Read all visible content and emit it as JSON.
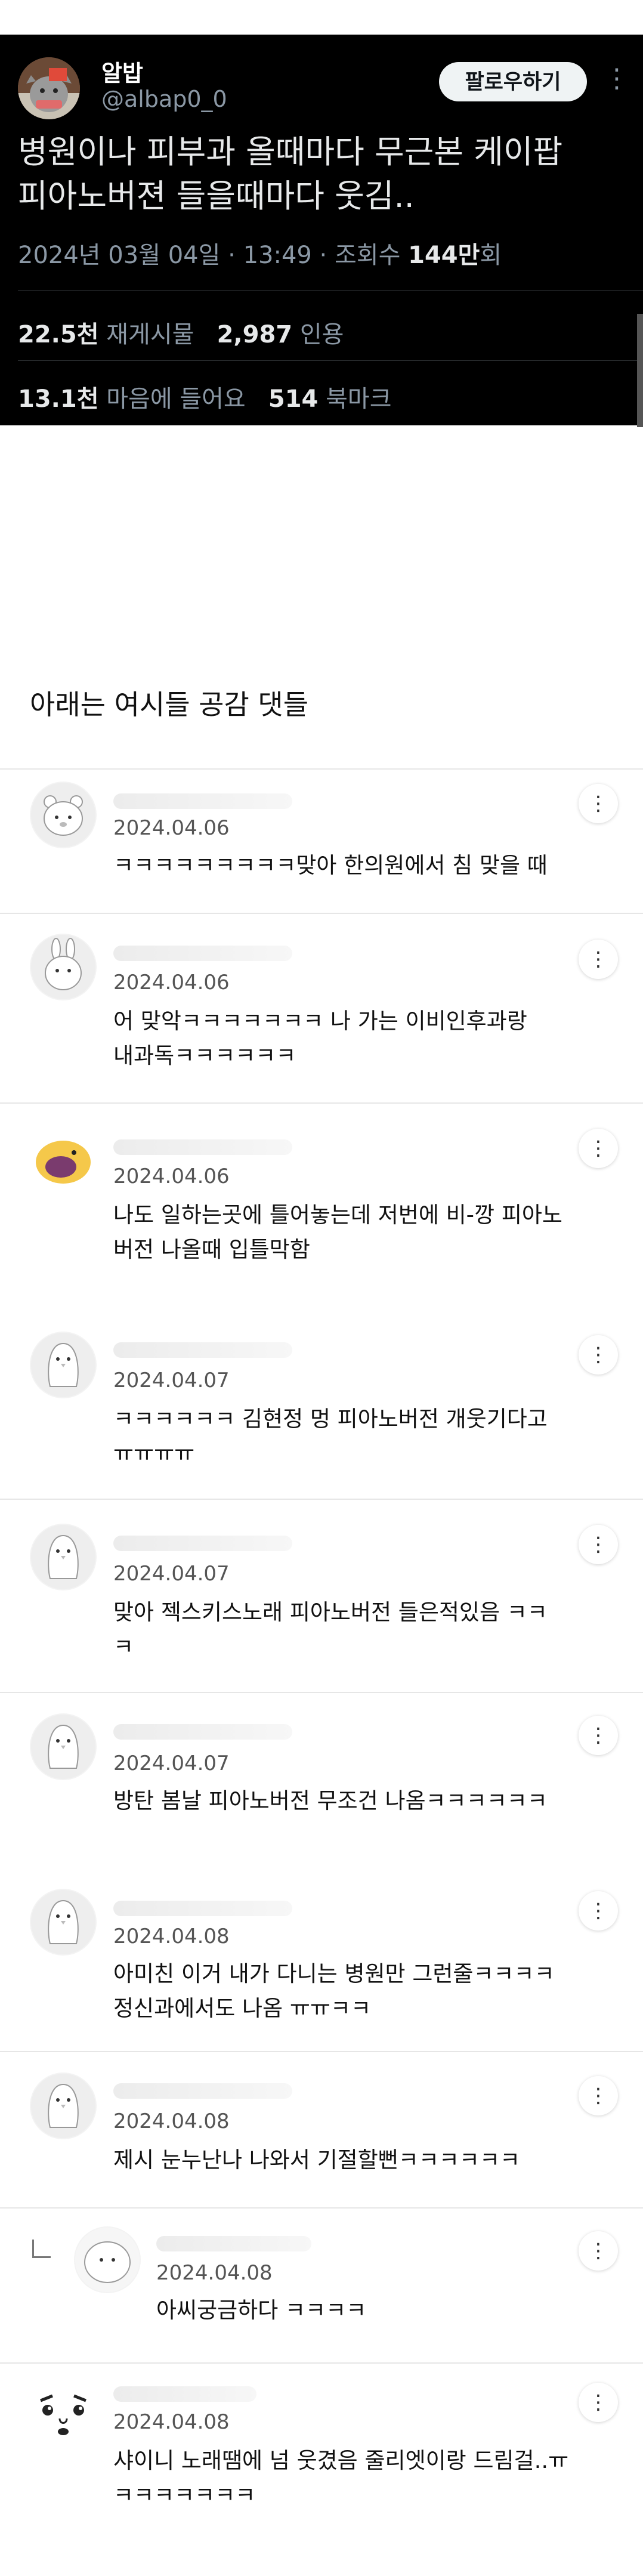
{
  "tweet": {
    "name": "알밥",
    "handle": "@albap0_0",
    "follow_label": "팔로우하기",
    "more_icon": "⋮",
    "text": "병원이나 피부과 올때마다 무근본 케이팝\n피아노버젼 들을때마다 웃김..",
    "meta_date": "2024년 03월 04일 · 13:49 · 조회수 ",
    "meta_views": "144만",
    "meta_views_unit": "회",
    "retweets": "22.5천",
    "retweets_label": " 재게시물",
    "quotes": "2,987",
    "quotes_label": " 인용",
    "likes": "13.1천",
    "likes_label": " 마음에 들어요",
    "bookmarks": "514",
    "bookmarks_label": " 북마크"
  },
  "section_title": "아래는 여시들 공감 댓들",
  "kebab_icon": "⋮",
  "comments": [
    {
      "date": "2024.04.06",
      "text": "ㅋㅋㅋㅋㅋㅋㅋㅋㅋ맞아 한의원에서 침 맞을 때"
    },
    {
      "date": "2024.04.06",
      "text": "어 맞악ㅋㅋㅋㅋㅋㅋㅋ 나 가는 이비인후과랑\n내과독ㅋㅋㅋㅋㅋㅋ"
    },
    {
      "date": "2024.04.06",
      "text": "나도 일하는곳에 틀어놓는데 저번에 비-깡 피아노\n버전 나올때 입틀막함"
    },
    {
      "date": "2024.04.07",
      "text": "ㅋㅋㅋㅋㅋㅋ 김현정 멍 피아노버전 개웃기다고\nㅠㅠㅠㅠ"
    },
    {
      "date": "2024.04.07",
      "text": "맞아 젝스키스노래 피아노버전 들은적있음 ㅋㅋ\nㅋ"
    },
    {
      "date": "2024.04.07",
      "text": "방탄 봄날 피아노버전 무조건 나옴ㅋㅋㅋㅋㅋㅋ"
    },
    {
      "date": "2024.04.08",
      "text": "아미친 이거 내가 다니는 병원만 그런줄ㅋㅋㅋㅋ\n정신과에서도 나옴 ㅠㅠㅋㅋ"
    },
    {
      "date": "2024.04.08",
      "text": "제시 눈누난나 나와서 기절할뻔ㅋㅋㅋㅋㅋㅋ"
    },
    {
      "date": "2024.04.08",
      "text": "아씨궁금하다 ㅋㅋㅋㅋ"
    },
    {
      "date": "2024.04.08",
      "text": "샤이니 노래땜에 넘 웃겼음 줄리엣이랑 드림걸..ㅠ\nㅋㅋㅋㅋㅋㅋㅋ"
    }
  ]
}
